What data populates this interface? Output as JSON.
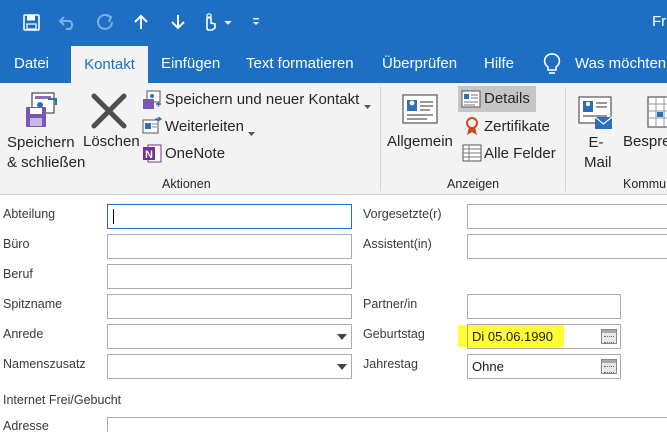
{
  "qat": {
    "icons": [
      "save-icon",
      "undo-icon",
      "redo-icon",
      "arrow-up-icon",
      "arrow-down-icon",
      "touch-mode-icon",
      "customize-icon"
    ]
  },
  "window": {
    "title": "Fr"
  },
  "tabs": [
    "Datei",
    "Kontakt",
    "Einfügen",
    "Text formatieren",
    "Überprüfen",
    "Hilfe",
    "Was möchten"
  ],
  "ribbon": {
    "actions": {
      "save_close": [
        "Speichern",
        "& schließen"
      ],
      "delete": "Löschen",
      "save_new": "Speichern und neuer Kontakt",
      "forward": "Weiterleiten",
      "onenote": "OneNote",
      "group": "Aktionen"
    },
    "show": {
      "general": "Allgemein",
      "details": "Details",
      "certificates": "Zertifikate",
      "all_fields": "Alle Felder",
      "group": "Anzeigen"
    },
    "communicate": {
      "email": [
        "E-",
        "Mail"
      ],
      "meeting": "Bespre",
      "group": "Kommu"
    }
  },
  "form": {
    "labels": {
      "department": "Abteilung",
      "office": "Büro",
      "profession": "Beruf",
      "nickname": "Spitzname",
      "title": "Anrede",
      "suffix": "Namenszusatz",
      "manager": "Vorgesetzte(r)",
      "assistant": "Assistent(in)",
      "partner": "Partner/in",
      "birthday": "Geburtstag",
      "anniversary": "Jahrestag",
      "internet_freebusy": "Internet Frei/Gebucht",
      "address": "Adresse"
    },
    "values": {
      "birthday": "Di 05.06.1990",
      "anniversary": "Ohne"
    },
    "highlight_color": "#ffff33"
  },
  "colors": {
    "brand": "#1e6fc3",
    "ribbon": "#f3f3f3"
  }
}
